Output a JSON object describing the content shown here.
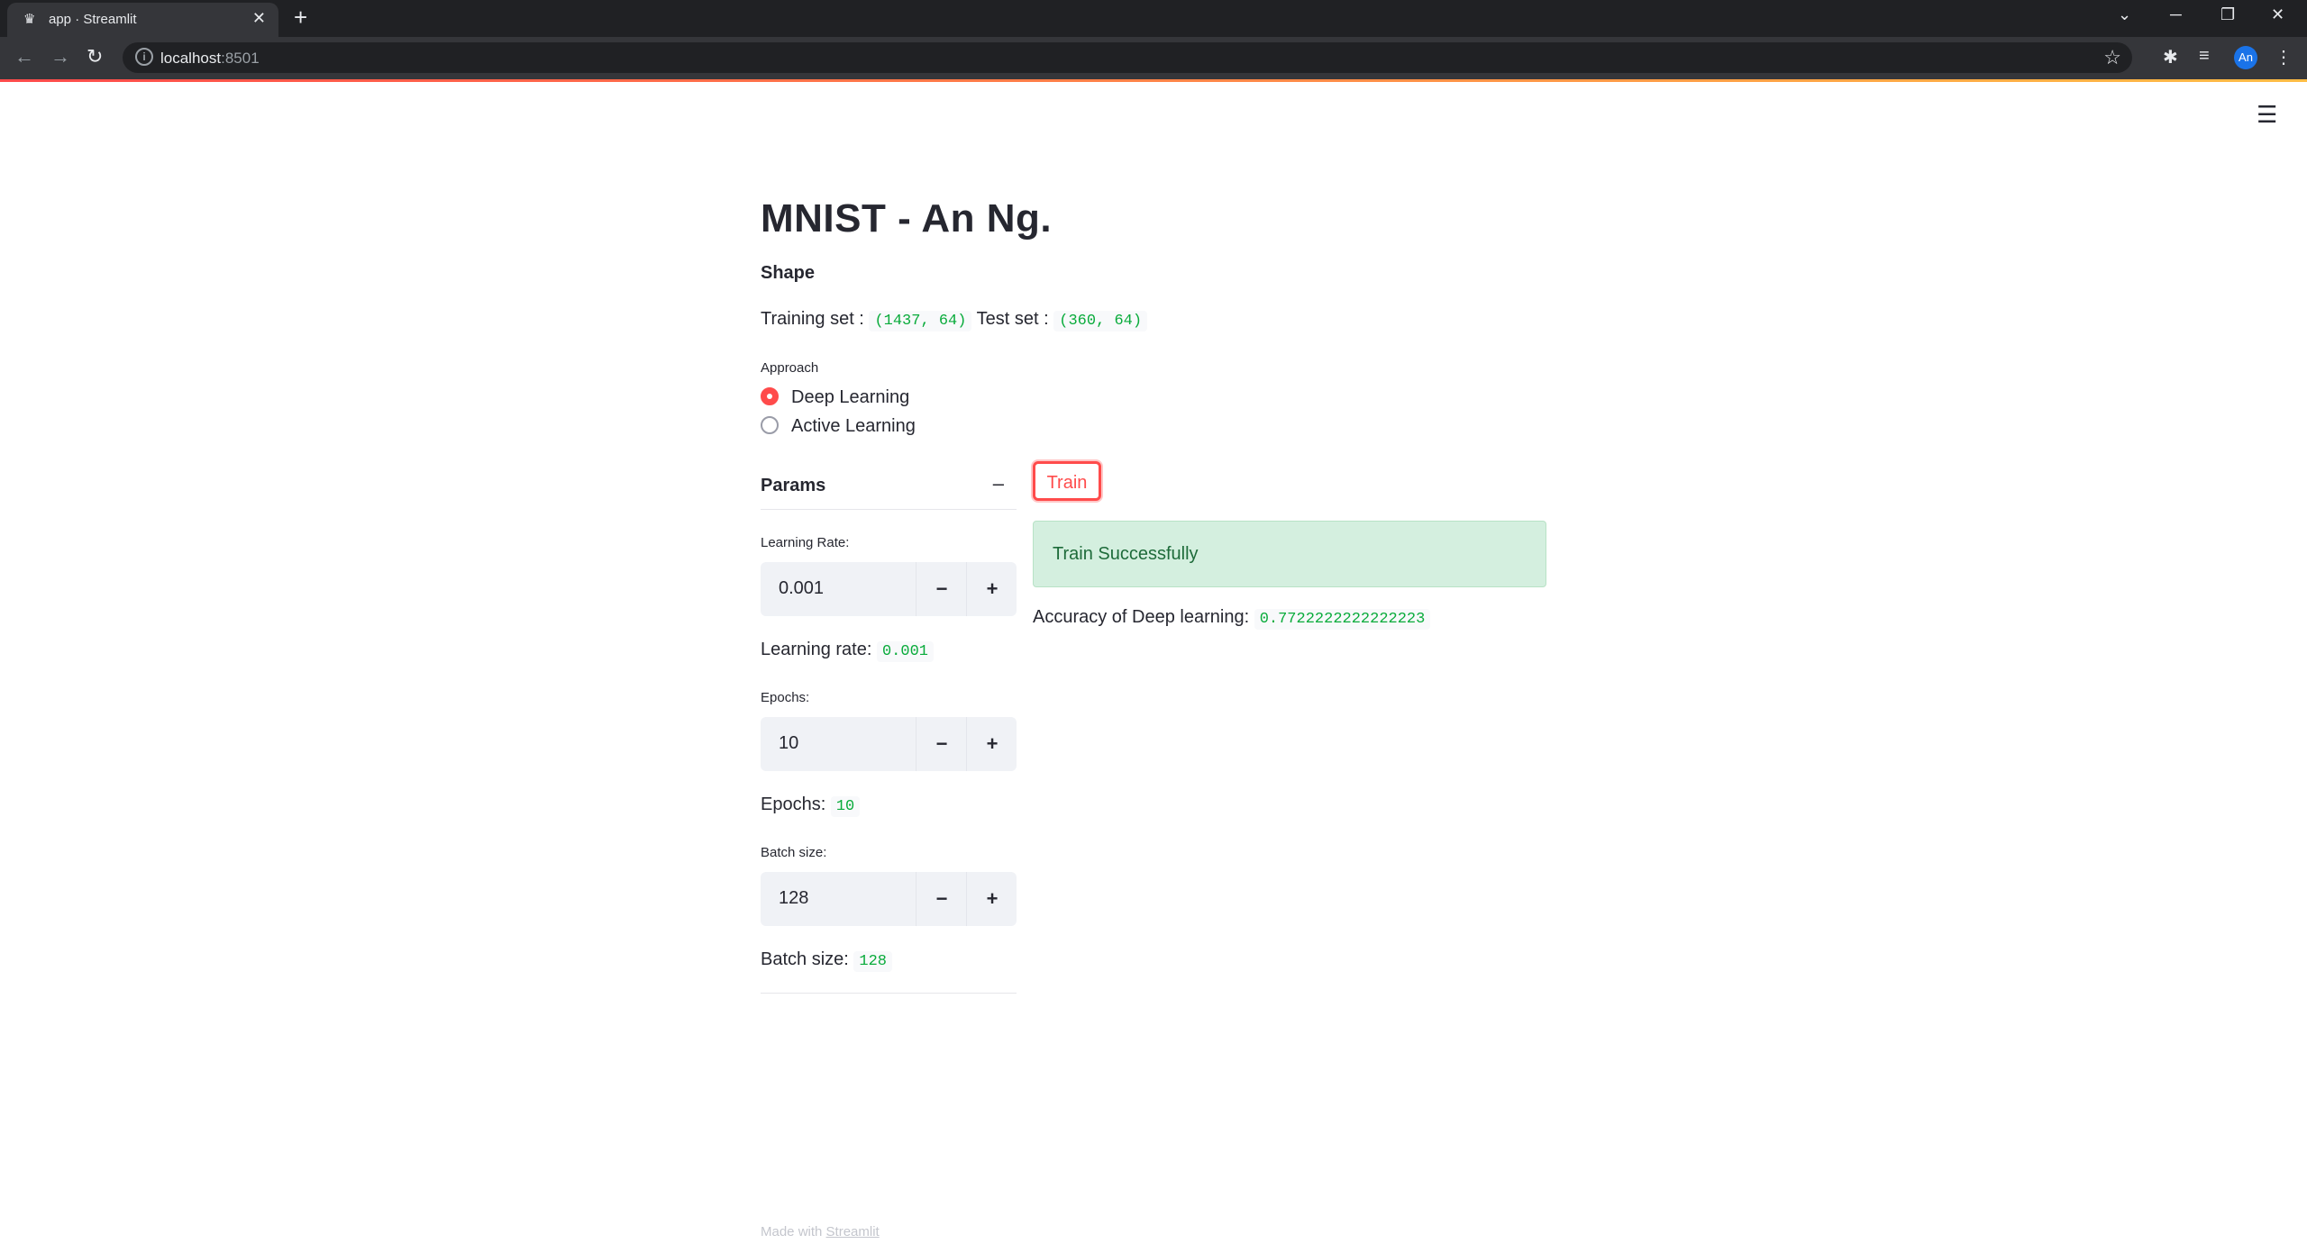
{
  "browser": {
    "tab_title": "app · Streamlit",
    "url_host": "localhost",
    "url_port": ":8501",
    "avatar_initials": "An"
  },
  "app": {
    "title": "MNIST - An Ng.",
    "shape_heading": "Shape",
    "training_set_label": "Training set :",
    "training_set_value": "(1437, 64)",
    "test_set_label": "Test set :",
    "test_set_value": "(360, 64)",
    "approach_label": "Approach",
    "approach_options": [
      "Deep Learning",
      "Active Learning"
    ],
    "approach_selected": "Deep Learning",
    "params_title": "Params",
    "learning_rate_label": "Learning Rate:",
    "learning_rate_value": "0.001",
    "learning_rate_out_label": "Learning rate:",
    "learning_rate_out_value": "0.001",
    "epochs_label": "Epochs:",
    "epochs_value": "10",
    "epochs_out_label": "Epochs:",
    "epochs_out_value": "10",
    "batch_label": "Batch size:",
    "batch_value": "128",
    "batch_out_label": "Batch size:",
    "batch_out_value": "128",
    "train_button": "Train",
    "success_message": "Train Successfully",
    "accuracy_label": "Accuracy of Deep learning:",
    "accuracy_value": "0.7722222222222223",
    "footer_text": "Made with",
    "footer_link": "Streamlit"
  },
  "colors": {
    "accent": "#ff4b4b",
    "code_green": "#09ab3b",
    "success_bg": "#d4efdf"
  }
}
